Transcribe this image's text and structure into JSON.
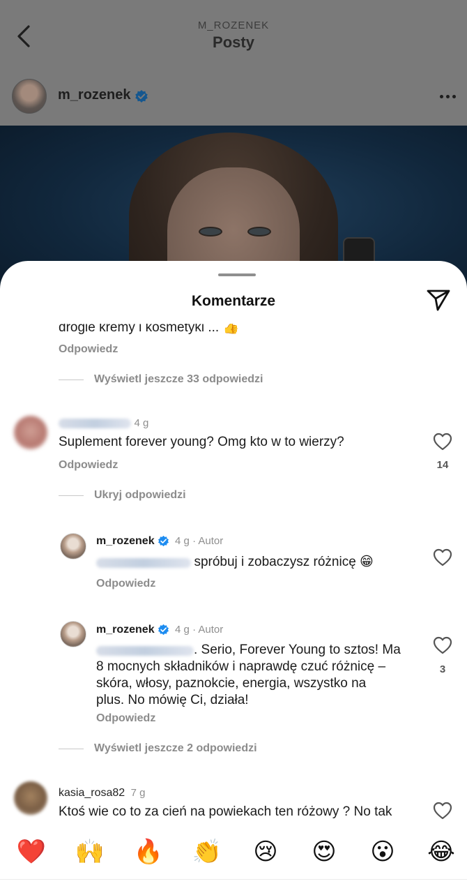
{
  "header": {
    "account_caps": "M_ROZENEK",
    "title": "Posty"
  },
  "post": {
    "username": "m_rozenek"
  },
  "sheet": {
    "title": "Komentarze"
  },
  "comments": {
    "partial": {
      "text": "drogie kremy i kosmetyki ... 👍",
      "reply_label": "Odpowiedz",
      "thread_toggle": "Wyświetl jeszcze 33 odpowiedzi"
    },
    "c1": {
      "time": "4 g",
      "text": "Suplement forever young? Omg kto w to wierzy?",
      "reply_label": "Odpowiedz",
      "likes": "14",
      "thread_toggle": "Ukryj odpowiedzi"
    },
    "r1": {
      "username": "m_rozenek",
      "meta": "4 g · Autor",
      "text": "spróbuj i zobaczysz różnicę 😁",
      "reply_label": "Odpowiedz"
    },
    "r2": {
      "username": "m_rozenek",
      "meta": "4 g · Autor",
      "line1": ". Serio, Forever Young to sztos! Ma",
      "line2": "8 mocnych składników i naprawdę czuć różnicę –",
      "line3": "skóra, włosy, paznokcie, energia, wszystko na",
      "line4": "plus. No mówię Ci, działa!",
      "reply_label": "Odpowiedz",
      "likes": "3",
      "thread_toggle": "Wyświetl jeszcze 2 odpowiedzi"
    },
    "c2": {
      "username": "kasia_rosa82",
      "time": "7 g",
      "text": "Ktoś wie co to za cień na powiekach ten różowy ? No tak"
    }
  },
  "emoji_bar": [
    "❤️",
    "🙌",
    "🔥",
    "👏",
    "😢",
    "😍",
    "😮",
    "😂"
  ],
  "colors": {
    "verified": "#1d8cf0",
    "muted_text": "#8b8b8b",
    "overlay": "#7a7a7a"
  }
}
